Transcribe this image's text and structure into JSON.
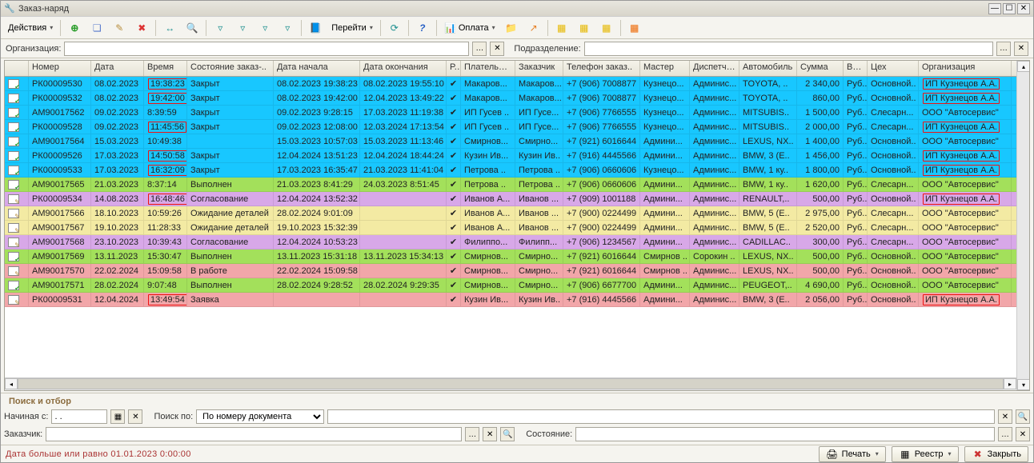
{
  "window": {
    "title": "Заказ-наряд"
  },
  "toolbar": {
    "actions_label": "Действия",
    "go_label": "Перейти",
    "pay_label": "Оплата"
  },
  "filter": {
    "org_label": "Организация:",
    "dept_label": "Подразделение:"
  },
  "columns": {
    "icon": "",
    "num": "Номер",
    "date": "Дата",
    "time": "Время",
    "state": "Состояние заказ-..",
    "start": "Дата начала",
    "end": "Дата окончания",
    "r": "Р...",
    "payer": "Плательщ...",
    "cust": "Заказчик",
    "phone": "Телефон заказ..",
    "master": "Мастер",
    "disp": "Диспетчер",
    "auto": "Автомобиль",
    "sum": "Сумма",
    "cur": "Вал..",
    "shop": "Цех",
    "org": "Организация"
  },
  "rows": [
    {
      "cls": "row-blue",
      "ic": "done",
      "num": "РК00009530",
      "date": "08.02.2023",
      "time": "19:38:23",
      "tbox": true,
      "state": "Закрыт",
      "start": "08.02.2023 19:38:23",
      "end": "08.02.2023 19:55:10",
      "r": "✔",
      "payer": "Макаров...",
      "cust": "Макаров...",
      "phone": "+7 (906) 7008877",
      "master": "Кузнецо...",
      "disp": "Админис...",
      "auto": "TOYOTA, ..",
      "sum": "2 340,00",
      "cur": "Руб..",
      "shop": "Основной..",
      "org": "ИП Кузнецов А.А.",
      "obox": true
    },
    {
      "cls": "row-blue",
      "ic": "done",
      "num": "РК00009532",
      "date": "08.02.2023",
      "time": "19:42:00",
      "tbox": true,
      "state": "Закрыт",
      "start": "08.02.2023 19:42:00",
      "end": "12.04.2023 13:49:22",
      "r": "✔",
      "payer": "Макаров...",
      "cust": "Макаров...",
      "phone": "+7 (906) 7008877",
      "master": "Кузнецо...",
      "disp": "Админис...",
      "auto": "TOYOTA, ..",
      "sum": "860,00",
      "cur": "Руб..",
      "shop": "Основной..",
      "org": "ИП Кузнецов А.А.",
      "obox": true
    },
    {
      "cls": "row-blue",
      "ic": "done",
      "num": "АМ90017562",
      "date": "09.02.2023",
      "time": "8:39:59",
      "tbox": false,
      "state": "Закрыт",
      "start": "09.02.2023 9:28:15",
      "end": "17.03.2023 11:19:38",
      "r": "✔",
      "payer": "ИП Гусев ..",
      "cust": "ИП Гусе...",
      "phone": "+7 (906) 7766555",
      "master": "Кузнецо...",
      "disp": "Админис...",
      "auto": "MITSUBIS..",
      "sum": "1 500,00",
      "cur": "Руб..",
      "shop": "Слесарн...",
      "org": "ООО \"Автосервис\"",
      "obox": false
    },
    {
      "cls": "row-blue",
      "ic": "done",
      "num": "РК00009528",
      "date": "09.02.2023",
      "time": "11:45:56",
      "tbox": true,
      "state": "Закрыт",
      "start": "09.02.2023 12:08:00",
      "end": "12.03.2024 17:13:54",
      "r": "✔",
      "payer": "ИП Гусев ..",
      "cust": "ИП Гусе...",
      "phone": "+7 (906) 7766555",
      "master": "Кузнецо...",
      "disp": "Админис...",
      "auto": "MITSUBIS..",
      "sum": "2 000,00",
      "cur": "Руб..",
      "shop": "Слесарн...",
      "org": "ИП Кузнецов А.А.",
      "obox": true
    },
    {
      "cls": "row-blue",
      "ic": "done",
      "num": "АМ90017564",
      "date": "15.03.2023",
      "time": "10:49:38",
      "tbox": false,
      "state": "",
      "start": "15.03.2023 10:57:03",
      "end": "15.03.2023 11:13:46",
      "r": "✔",
      "payer": "Смирнов...",
      "cust": "Смирно...",
      "phone": "+7 (921) 6016644",
      "master": "Админи...",
      "disp": "Админис...",
      "auto": "LEXUS, NX..",
      "sum": "1 400,00",
      "cur": "Руб..",
      "shop": "Основной..",
      "org": "ООО \"Автосервис\"",
      "obox": false
    },
    {
      "cls": "row-blue",
      "ic": "done",
      "num": "РК00009526",
      "date": "17.03.2023",
      "time": "14:50:58",
      "tbox": true,
      "state": "Закрыт",
      "start": "12.04.2024 13:51:23",
      "end": "12.04.2024 18:44:24",
      "r": "✔",
      "payer": "Кузин Ив...",
      "cust": "Кузин Ив..",
      "phone": "+7 (916) 4445566",
      "master": "Админи...",
      "disp": "Админис...",
      "auto": "BMW, 3 (E..",
      "sum": "1 456,00",
      "cur": "Руб..",
      "shop": "Основной..",
      "org": "ИП Кузнецов А.А.",
      "obox": true
    },
    {
      "cls": "row-blue",
      "ic": "done",
      "num": "РК00009533",
      "date": "17.03.2023",
      "time": "16:32:09",
      "tbox": true,
      "state": "Закрыт",
      "start": "17.03.2023 16:35:47",
      "end": "21.03.2023 11:41:04",
      "r": "✔",
      "payer": "Петрова ..",
      "cust": "Петрова ..",
      "phone": "+7 (906) 0660606",
      "master": "Кузнецо...",
      "disp": "Админис...",
      "auto": "BMW, 1 ку..",
      "sum": "1 800,00",
      "cur": "Руб..",
      "shop": "Основной..",
      "org": "ИП Кузнецов А.А.",
      "obox": true
    },
    {
      "cls": "row-green",
      "ic": "done",
      "num": "АМ90017565",
      "date": "21.03.2023",
      "time": "8:37:14",
      "tbox": false,
      "state": "Выполнен",
      "start": "21.03.2023 8:41:29",
      "end": "24.03.2023 8:51:45",
      "r": "✔",
      "payer": "Петрова ..",
      "cust": "Петрова ..",
      "phone": "+7 (906) 0660606",
      "master": "Админи...",
      "disp": "Админис...",
      "auto": "BMW, 1 ку..",
      "sum": "1 620,00",
      "cur": "Руб..",
      "shop": "Слесарн...",
      "org": "ООО \"Автосервис\"",
      "obox": false
    },
    {
      "cls": "row-purple",
      "ic": "edit",
      "num": "РК00009534",
      "date": "14.08.2023",
      "time": "16:48:46",
      "tbox": true,
      "state": "Согласование",
      "start": "12.04.2024 13:52:32",
      "end": "",
      "r": "✔",
      "payer": "Иванов А...",
      "cust": "Иванов ...",
      "phone": "+7 (909) 1001188",
      "master": "Админи...",
      "disp": "Админис...",
      "auto": "RENAULT,..",
      "sum": "500,00",
      "cur": "Руб..",
      "shop": "Основной..",
      "org": "ИП Кузнецов А.А.",
      "obox": true
    },
    {
      "cls": "row-yellow",
      "ic": "edit",
      "num": "АМ90017566",
      "date": "18.10.2023",
      "time": "10:59:26",
      "tbox": false,
      "state": "Ожидание деталей",
      "start": "28.02.2024 9:01:09",
      "end": "",
      "r": "✔",
      "payer": "Иванов А...",
      "cust": "Иванов ...",
      "phone": "+7 (900) 0224499",
      "master": "Админи...",
      "disp": "Админис...",
      "auto": "BMW, 5 (E..",
      "sum": "2 975,00",
      "cur": "Руб..",
      "shop": "Слесарн...",
      "org": "ООО \"Автосервис\"",
      "obox": false
    },
    {
      "cls": "row-yellow",
      "ic": "edit",
      "num": "АМ90017567",
      "date": "19.10.2023",
      "time": "11:28:33",
      "tbox": false,
      "state": "Ожидание деталей",
      "start": "19.10.2023 15:32:39",
      "end": "",
      "r": "✔",
      "payer": "Иванов А...",
      "cust": "Иванов ...",
      "phone": "+7 (900) 0224499",
      "master": "Админи...",
      "disp": "Админис...",
      "auto": "BMW, 5 (E..",
      "sum": "2 520,00",
      "cur": "Руб..",
      "shop": "Слесарн...",
      "org": "ООО \"Автосервис\"",
      "obox": false
    },
    {
      "cls": "row-purple",
      "ic": "edit",
      "num": "АМ90017568",
      "date": "23.10.2023",
      "time": "10:39:43",
      "tbox": false,
      "state": "Согласование",
      "start": "12.04.2024 10:53:23",
      "end": "",
      "r": "✔",
      "payer": "Филиппо...",
      "cust": "Филипп...",
      "phone": "+7 (906) 1234567",
      "master": "Админи...",
      "disp": "Админис...",
      "auto": "CADILLAC..",
      "sum": "300,00",
      "cur": "Руб..",
      "shop": "Слесарн...",
      "org": "ООО \"Автосервис\"",
      "obox": false
    },
    {
      "cls": "row-green",
      "ic": "done",
      "num": "АМ90017569",
      "date": "13.11.2023",
      "time": "15:30:47",
      "tbox": false,
      "state": "Выполнен",
      "start": "13.11.2023 15:31:18",
      "end": "13.11.2023 15:34:13",
      "r": "✔",
      "payer": "Смирнов...",
      "cust": "Смирно...",
      "phone": "+7 (921) 6016644",
      "master": "Смирнов ..",
      "disp": "Сорокин ..",
      "auto": "LEXUS, NX..",
      "sum": "500,00",
      "cur": "Руб..",
      "shop": "Основной..",
      "org": "ООО \"Автосервис\"",
      "obox": false
    },
    {
      "cls": "row-pink",
      "ic": "edit",
      "num": "АМ90017570",
      "date": "22.02.2024",
      "time": "15:09:58",
      "tbox": false,
      "state": "В работе",
      "start": "22.02.2024 15:09:58",
      "end": "",
      "r": "✔",
      "payer": "Смирнов...",
      "cust": "Смирно...",
      "phone": "+7 (921) 6016644",
      "master": "Смирнов ..",
      "disp": "Админис...",
      "auto": "LEXUS, NX..",
      "sum": "500,00",
      "cur": "Руб..",
      "shop": "Основной..",
      "org": "ООО \"Автосервис\"",
      "obox": false
    },
    {
      "cls": "row-green",
      "ic": "done",
      "num": "АМ90017571",
      "date": "28.02.2024",
      "time": "9:07:48",
      "tbox": false,
      "state": "Выполнен",
      "start": "28.02.2024 9:28:52",
      "end": "28.02.2024 9:29:35",
      "r": "✔",
      "payer": "Смирнов...",
      "cust": "Смирно...",
      "phone": "+7 (906) 6677700",
      "master": "Админи...",
      "disp": "Админис...",
      "auto": "PEUGEOT,..",
      "sum": "4 690,00",
      "cur": "Руб..",
      "shop": "Основной..",
      "org": "ООО \"Автосервис\"",
      "obox": false
    },
    {
      "cls": "row-pink",
      "ic": "edit",
      "num": "РК00009531",
      "date": "12.04.2024",
      "time": "13:49:54",
      "tbox": true,
      "state": "Заявка",
      "start": "",
      "end": "",
      "r": "✔",
      "payer": "Кузин Ив...",
      "cust": "Кузин Ив..",
      "phone": "+7 (916) 4445566",
      "master": "Админи...",
      "disp": "Админис...",
      "auto": "BMW, 3 (E..",
      "sum": "2 056,00",
      "cur": "Руб..",
      "shop": "Основной..",
      "org": "ИП Кузнецов А.А.",
      "obox": true
    }
  ],
  "search": {
    "heading": "Поиск и отбор",
    "starts_label": "Начиная с:",
    "starts_value": ". .",
    "by_label": "Поиск по:",
    "by_value": "По номеру документа",
    "cust_label": "Заказчик:",
    "state_label": "Состояние:"
  },
  "status": {
    "text": "Дата больше или равно 01.01.2023 0:00:00",
    "print": "Печать",
    "registry": "Реестр",
    "close": "Закрыть"
  }
}
